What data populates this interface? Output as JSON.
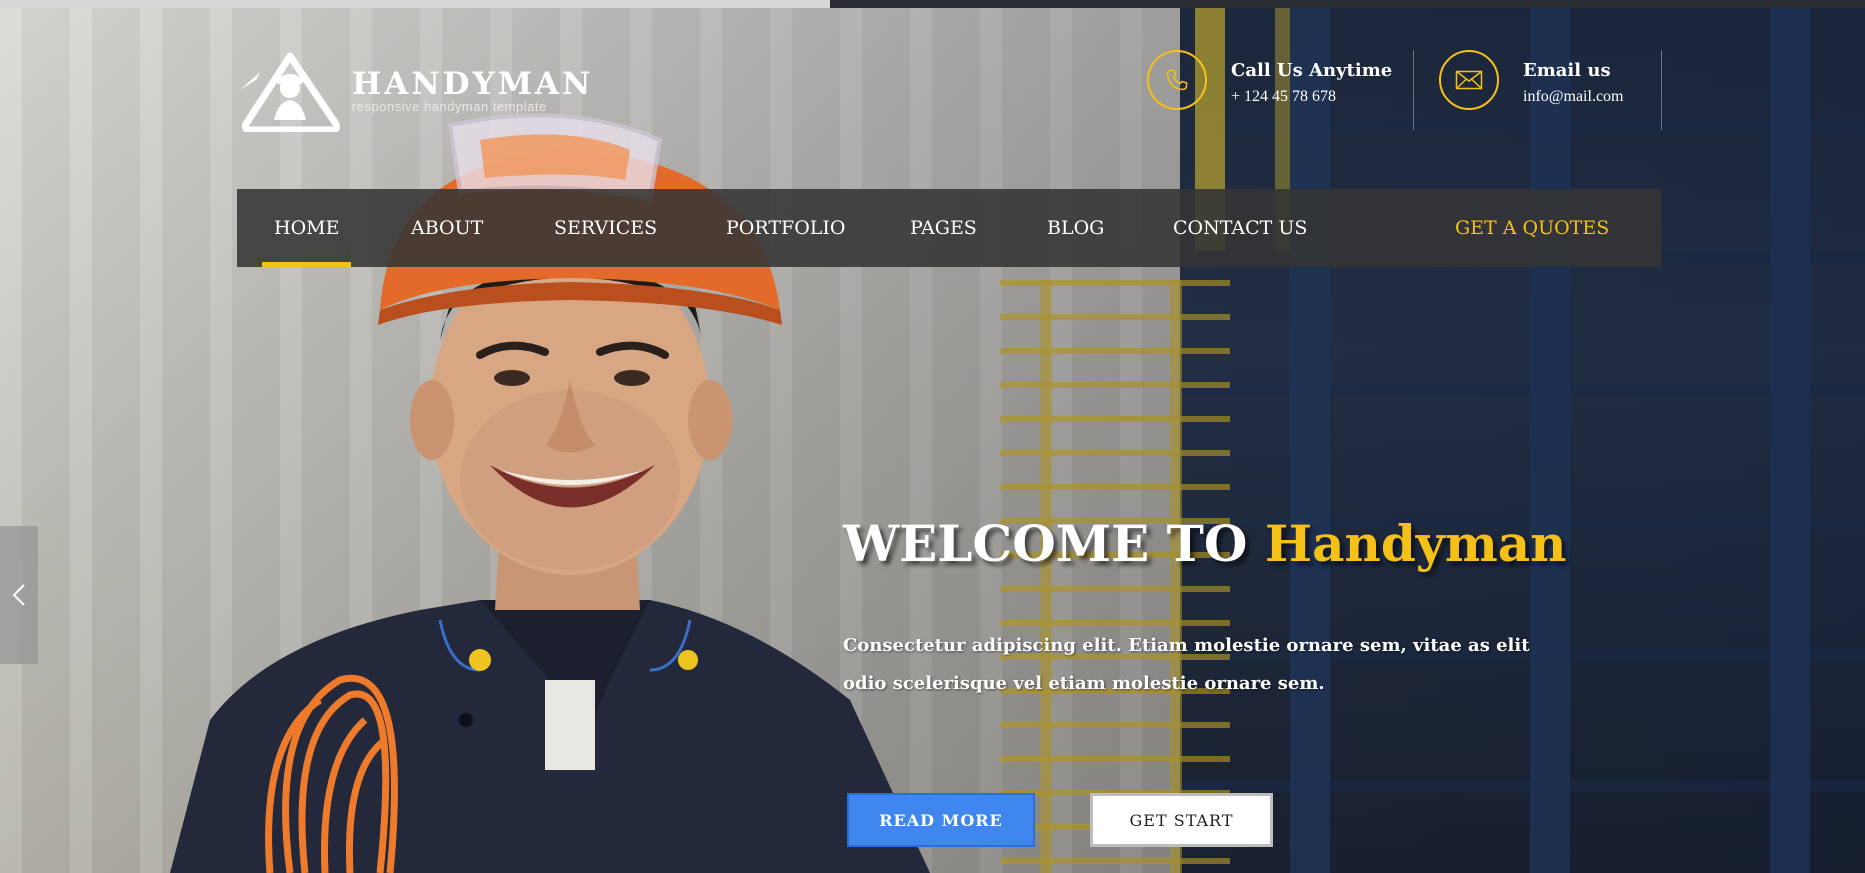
{
  "slider": {
    "progress_fraction": 0.445
  },
  "brand": {
    "name": "HANDYMAN",
    "tagline": "responsive handyman template",
    "logo_icon": "handyman-helmet-logo"
  },
  "header": {
    "call": {
      "icon": "phone-icon",
      "title": "Call Us Anytime",
      "value": "+ 124 45 78 678"
    },
    "email": {
      "icon": "envelope-icon",
      "title": "Email us",
      "value": "info@mail.com"
    }
  },
  "nav": {
    "items": [
      {
        "label": "HOME",
        "active": true
      },
      {
        "label": "ABOUT"
      },
      {
        "label": "SERVICES"
      },
      {
        "label": "PORTFOLIO"
      },
      {
        "label": "PAGES"
      },
      {
        "label": "BLOG"
      },
      {
        "label": "CONTACT US"
      }
    ],
    "cta": "GET A QUOTES"
  },
  "hero": {
    "title_prefix": "WELCOME TO",
    "title_accent": "Handyman",
    "description": "Consectetur adipiscing elit. Etiam molestie ornare sem, vitae as elit odio scelerisque vel etiam molestie ornare sem.",
    "primary_button": "READ MORE",
    "secondary_button": "GET START"
  },
  "colors": {
    "accent": "#f5c118",
    "primary_button": "#3f86ee",
    "nav_background": "#343434"
  },
  "controls": {
    "prev_icon": "chevron-left-icon"
  }
}
